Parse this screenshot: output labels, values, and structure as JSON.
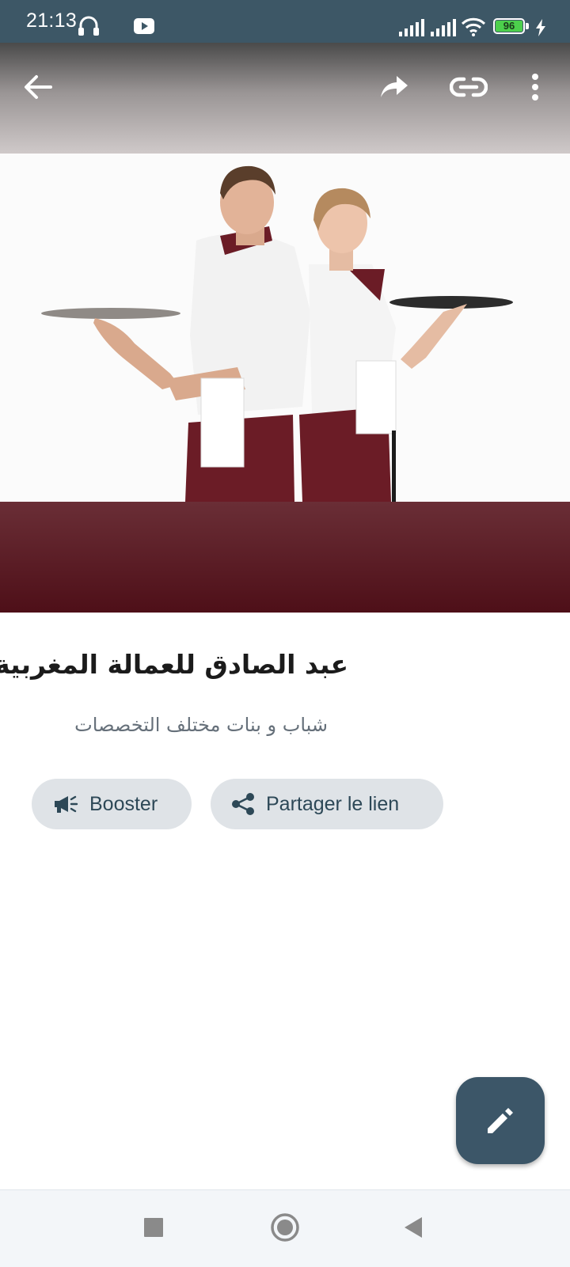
{
  "status_bar": {
    "time": "21:13",
    "battery_level": "96",
    "icons": [
      "headset-icon",
      "youtube-icon",
      "signal-icon",
      "signal-icon",
      "wifi-icon",
      "battery-icon",
      "charging-icon"
    ]
  },
  "app_bar": {
    "icons": [
      "back-arrow-icon",
      "share-forward-icon",
      "link-icon",
      "more-vert-icon"
    ]
  },
  "media": {
    "progress": 0.075
  },
  "listing": {
    "title": "عبد الصادق للعمالة المغربية",
    "description": "شباب و بنات مختلف التخصصات"
  },
  "actions": {
    "boost_label": "Booster",
    "share_label": "Partager le lien"
  },
  "fab": {
    "icon": "edit-pencil-icon"
  },
  "nav_bar": {
    "icons": [
      "recents-square-icon",
      "home-circle-icon",
      "back-triangle-icon"
    ]
  },
  "colors": {
    "status_bar": "#3d5766",
    "accent": "#3c5668",
    "chip_bg": "#dfe3e7",
    "chip_text": "#2d4857",
    "hero_bottom": "#4e0f18"
  }
}
